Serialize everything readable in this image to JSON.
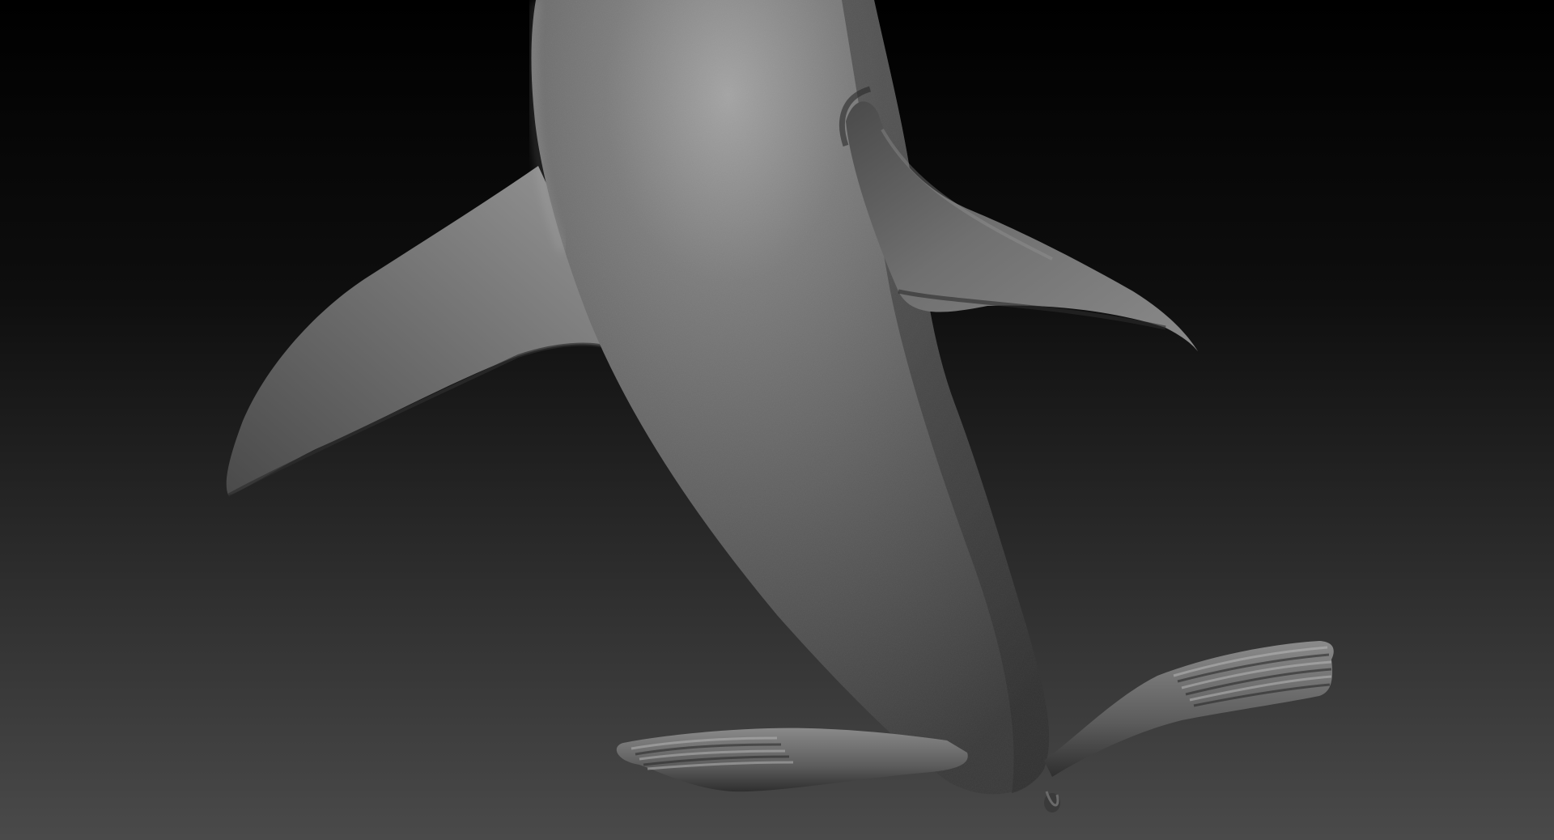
{
  "scene": {
    "subject": "sculpt-model",
    "colors": {
      "background_top": "#000000",
      "background_bottom": "#4a4a4a",
      "material_highlight": "#a8a8a8",
      "material_mid": "#6e6e6e",
      "material_shadow": "#262626"
    }
  }
}
